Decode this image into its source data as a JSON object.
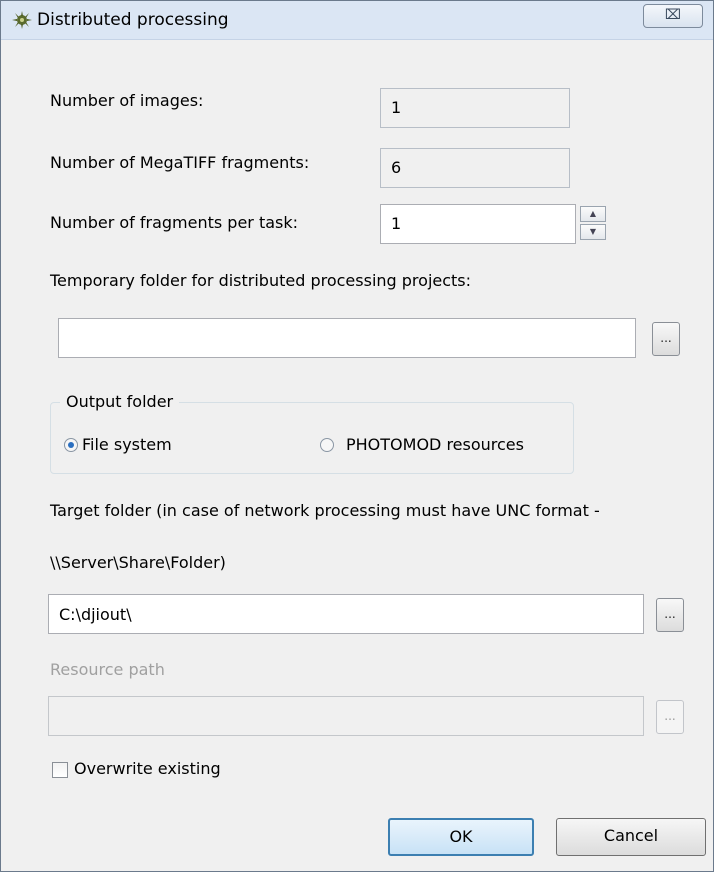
{
  "window": {
    "title": "Distributed processing",
    "close_label": "⌧"
  },
  "images": {
    "label": "Number of images:",
    "value": "1"
  },
  "fragments": {
    "label": "Number of MegaTIFF fragments:",
    "value": "6"
  },
  "per_task": {
    "label": "Number of fragments per task:",
    "value": "1"
  },
  "temp_folder": {
    "label": "Temporary folder for distributed processing projects:",
    "value": "",
    "browse_label": "..."
  },
  "output_folder": {
    "title": "Output folder",
    "options": [
      {
        "label": "File system",
        "selected": true
      },
      {
        "label": "PHOTOMOD resources",
        "selected": false
      }
    ]
  },
  "target_folder": {
    "label_line1": "Target folder (in case of network processing must have UNC format -",
    "label_line2": "\\\\Server\\Share\\Folder)",
    "value": "C:\\djiout\\",
    "browse_label": "..."
  },
  "resource_path": {
    "label": "Resource path",
    "value": "",
    "browse_label": "..."
  },
  "overwrite": {
    "label": "Overwrite existing",
    "checked": false
  },
  "buttons": {
    "ok": "OK",
    "cancel": "Cancel"
  }
}
